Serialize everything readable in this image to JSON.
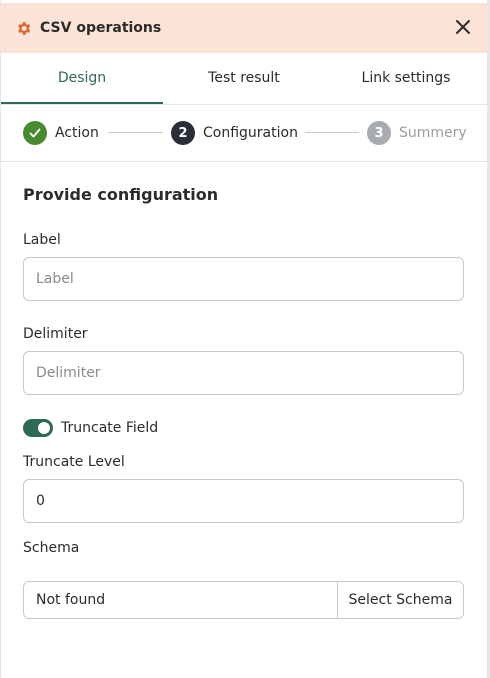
{
  "header": {
    "title": "CSV operations",
    "icon": "gear-icon",
    "close_icon": "close-icon",
    "accent_color": "#e0662f",
    "background_color": "#fbe3d8"
  },
  "tabs": [
    {
      "label": "Design",
      "active": true
    },
    {
      "label": "Test result",
      "active": false
    },
    {
      "label": "Link settings",
      "active": false
    }
  ],
  "stepper": {
    "steps": [
      {
        "label": "Action",
        "state": "done",
        "icon": "check-icon"
      },
      {
        "label": "Configuration",
        "state": "current",
        "number": "2"
      },
      {
        "label": "Summery",
        "state": "upcoming",
        "number": "3"
      }
    ]
  },
  "form": {
    "title": "Provide configuration",
    "label_field": {
      "label": "Label",
      "value": "",
      "placeholder": "Label"
    },
    "delimiter_field": {
      "label": "Delimiter",
      "value": "",
      "placeholder": "Delimiter"
    },
    "truncate_toggle": {
      "label": "Truncate Field",
      "on": true
    },
    "truncate_level_field": {
      "label": "Truncate Level",
      "value": "0"
    },
    "schema": {
      "label": "Schema",
      "value": "Not found",
      "button_label": "Select Schema"
    }
  },
  "colors": {
    "primary": "#2d6a55",
    "step_done": "#4a8a2e",
    "step_current": "#2b2e3a",
    "step_upcoming": "#a8abb0"
  }
}
